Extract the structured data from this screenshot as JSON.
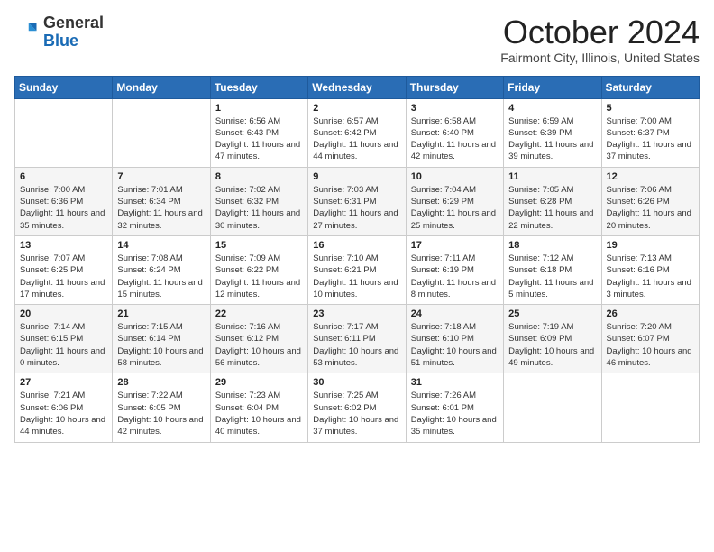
{
  "header": {
    "logo_general": "General",
    "logo_blue": "Blue",
    "month_title": "October 2024",
    "location": "Fairmont City, Illinois, United States"
  },
  "weekdays": [
    "Sunday",
    "Monday",
    "Tuesday",
    "Wednesday",
    "Thursday",
    "Friday",
    "Saturday"
  ],
  "weeks": [
    [
      {
        "day": "",
        "info": ""
      },
      {
        "day": "",
        "info": ""
      },
      {
        "day": "1",
        "info": "Sunrise: 6:56 AM\nSunset: 6:43 PM\nDaylight: 11 hours and 47 minutes."
      },
      {
        "day": "2",
        "info": "Sunrise: 6:57 AM\nSunset: 6:42 PM\nDaylight: 11 hours and 44 minutes."
      },
      {
        "day": "3",
        "info": "Sunrise: 6:58 AM\nSunset: 6:40 PM\nDaylight: 11 hours and 42 minutes."
      },
      {
        "day": "4",
        "info": "Sunrise: 6:59 AM\nSunset: 6:39 PM\nDaylight: 11 hours and 39 minutes."
      },
      {
        "day": "5",
        "info": "Sunrise: 7:00 AM\nSunset: 6:37 PM\nDaylight: 11 hours and 37 minutes."
      }
    ],
    [
      {
        "day": "6",
        "info": "Sunrise: 7:00 AM\nSunset: 6:36 PM\nDaylight: 11 hours and 35 minutes."
      },
      {
        "day": "7",
        "info": "Sunrise: 7:01 AM\nSunset: 6:34 PM\nDaylight: 11 hours and 32 minutes."
      },
      {
        "day": "8",
        "info": "Sunrise: 7:02 AM\nSunset: 6:32 PM\nDaylight: 11 hours and 30 minutes."
      },
      {
        "day": "9",
        "info": "Sunrise: 7:03 AM\nSunset: 6:31 PM\nDaylight: 11 hours and 27 minutes."
      },
      {
        "day": "10",
        "info": "Sunrise: 7:04 AM\nSunset: 6:29 PM\nDaylight: 11 hours and 25 minutes."
      },
      {
        "day": "11",
        "info": "Sunrise: 7:05 AM\nSunset: 6:28 PM\nDaylight: 11 hours and 22 minutes."
      },
      {
        "day": "12",
        "info": "Sunrise: 7:06 AM\nSunset: 6:26 PM\nDaylight: 11 hours and 20 minutes."
      }
    ],
    [
      {
        "day": "13",
        "info": "Sunrise: 7:07 AM\nSunset: 6:25 PM\nDaylight: 11 hours and 17 minutes."
      },
      {
        "day": "14",
        "info": "Sunrise: 7:08 AM\nSunset: 6:24 PM\nDaylight: 11 hours and 15 minutes."
      },
      {
        "day": "15",
        "info": "Sunrise: 7:09 AM\nSunset: 6:22 PM\nDaylight: 11 hours and 12 minutes."
      },
      {
        "day": "16",
        "info": "Sunrise: 7:10 AM\nSunset: 6:21 PM\nDaylight: 11 hours and 10 minutes."
      },
      {
        "day": "17",
        "info": "Sunrise: 7:11 AM\nSunset: 6:19 PM\nDaylight: 11 hours and 8 minutes."
      },
      {
        "day": "18",
        "info": "Sunrise: 7:12 AM\nSunset: 6:18 PM\nDaylight: 11 hours and 5 minutes."
      },
      {
        "day": "19",
        "info": "Sunrise: 7:13 AM\nSunset: 6:16 PM\nDaylight: 11 hours and 3 minutes."
      }
    ],
    [
      {
        "day": "20",
        "info": "Sunrise: 7:14 AM\nSunset: 6:15 PM\nDaylight: 11 hours and 0 minutes."
      },
      {
        "day": "21",
        "info": "Sunrise: 7:15 AM\nSunset: 6:14 PM\nDaylight: 10 hours and 58 minutes."
      },
      {
        "day": "22",
        "info": "Sunrise: 7:16 AM\nSunset: 6:12 PM\nDaylight: 10 hours and 56 minutes."
      },
      {
        "day": "23",
        "info": "Sunrise: 7:17 AM\nSunset: 6:11 PM\nDaylight: 10 hours and 53 minutes."
      },
      {
        "day": "24",
        "info": "Sunrise: 7:18 AM\nSunset: 6:10 PM\nDaylight: 10 hours and 51 minutes."
      },
      {
        "day": "25",
        "info": "Sunrise: 7:19 AM\nSunset: 6:09 PM\nDaylight: 10 hours and 49 minutes."
      },
      {
        "day": "26",
        "info": "Sunrise: 7:20 AM\nSunset: 6:07 PM\nDaylight: 10 hours and 46 minutes."
      }
    ],
    [
      {
        "day": "27",
        "info": "Sunrise: 7:21 AM\nSunset: 6:06 PM\nDaylight: 10 hours and 44 minutes."
      },
      {
        "day": "28",
        "info": "Sunrise: 7:22 AM\nSunset: 6:05 PM\nDaylight: 10 hours and 42 minutes."
      },
      {
        "day": "29",
        "info": "Sunrise: 7:23 AM\nSunset: 6:04 PM\nDaylight: 10 hours and 40 minutes."
      },
      {
        "day": "30",
        "info": "Sunrise: 7:25 AM\nSunset: 6:02 PM\nDaylight: 10 hours and 37 minutes."
      },
      {
        "day": "31",
        "info": "Sunrise: 7:26 AM\nSunset: 6:01 PM\nDaylight: 10 hours and 35 minutes."
      },
      {
        "day": "",
        "info": ""
      },
      {
        "day": "",
        "info": ""
      }
    ]
  ]
}
